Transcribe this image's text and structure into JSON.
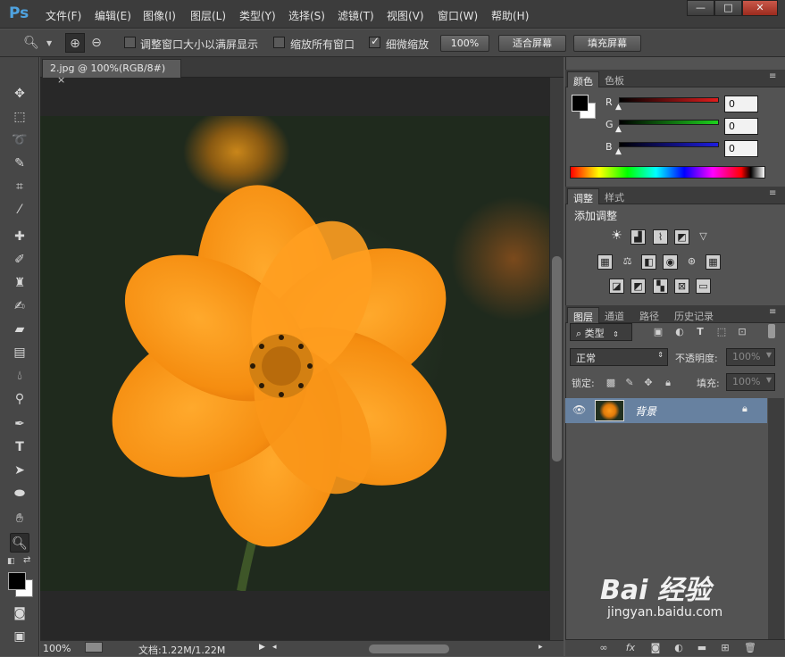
{
  "app": {
    "logo": "Ps"
  },
  "menu": [
    "文件(F)",
    "编辑(E)",
    "图像(I)",
    "图层(L)",
    "类型(Y)",
    "选择(S)",
    "滤镜(T)",
    "视图(V)",
    "窗口(W)",
    "帮助(H)"
  ],
  "window_controls": {
    "minimize": "—",
    "maximize": "□",
    "close": "✕"
  },
  "options_bar": {
    "resize_windows_label": "调整窗口大小以满屏显示",
    "resize_windows_checked": false,
    "zoom_all_label": "缩放所有窗口",
    "zoom_all_checked": false,
    "scrubby_zoom_label": "细微缩放",
    "scrubby_zoom_checked": true,
    "btn_100": "100%",
    "btn_fit": "适合屏幕",
    "btn_fill": "填充屏幕"
  },
  "document": {
    "tab_title": "2.jpg @ 100%(RGB/8#)",
    "tab_close": "×"
  },
  "status": {
    "zoom": "100%",
    "doc_info": "文档:1.22M/1.22M"
  },
  "color_panel": {
    "tabs": [
      "颜色",
      "色板"
    ],
    "channels": [
      {
        "label": "R",
        "value": "0",
        "color": "#d11c1c"
      },
      {
        "label": "G",
        "value": "0",
        "color": "#1cc71c"
      },
      {
        "label": "B",
        "value": "0",
        "color": "#1c1cd1"
      }
    ],
    "foreground": "#000000",
    "background": "#ffffff"
  },
  "adjust_panel": {
    "tabs": [
      "调整",
      "样式"
    ],
    "title": "添加调整"
  },
  "layers_panel": {
    "tabs": [
      "图层",
      "通道",
      "路径",
      "历史记录"
    ],
    "filter_label": "类型",
    "blend_mode": "正常",
    "opacity_label": "不透明度:",
    "opacity_value": "100%",
    "lock_label": "锁定:",
    "fill_label": "填充:",
    "fill_value": "100%",
    "layers": [
      {
        "name": "背景",
        "visible": true,
        "locked": true
      }
    ]
  },
  "watermark": {
    "brand": "Bai 经验",
    "url": "jingyan.baidu.com"
  }
}
